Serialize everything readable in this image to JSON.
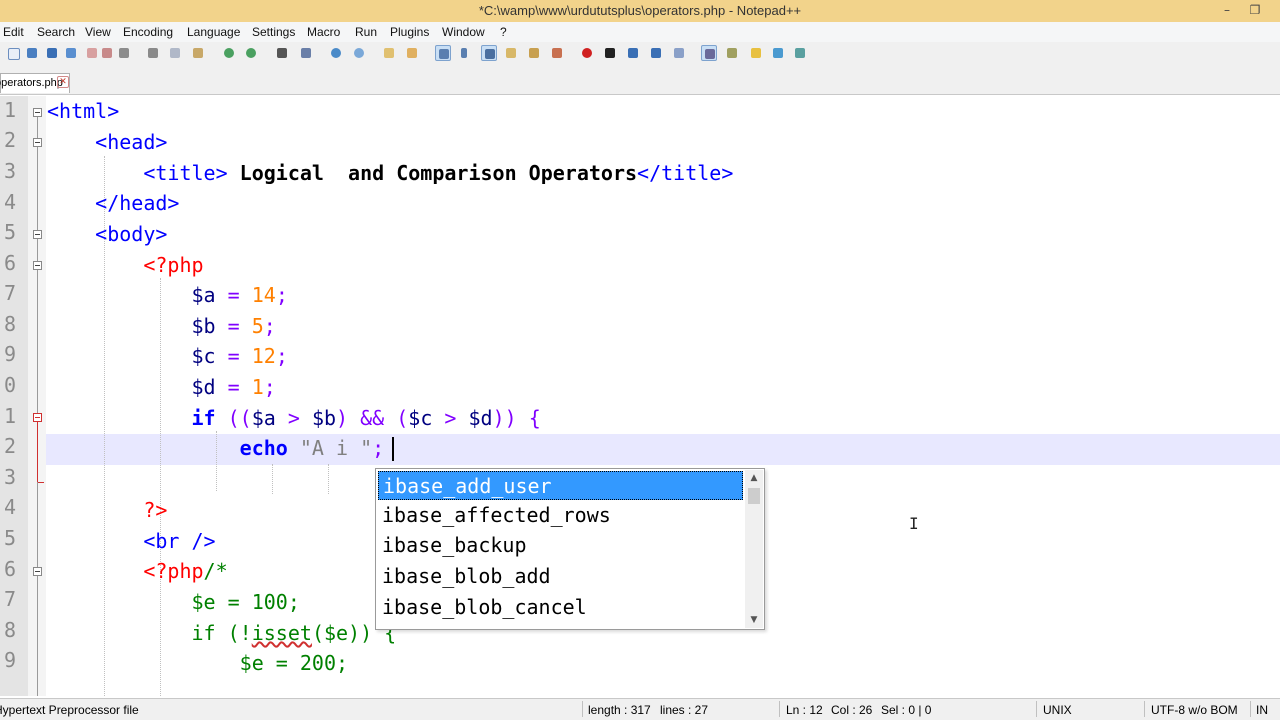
{
  "window": {
    "title": "*C:\\wamp\\www\\urdututsplus\\operators.php - Notepad++",
    "minimize_glyph": "–",
    "restore_glyph": "❐"
  },
  "menu": [
    "Edit",
    "Search",
    "View",
    "Encoding",
    "Language",
    "Settings",
    "Macro",
    "Run",
    "Plugins",
    "Window",
    "?"
  ],
  "tab": {
    "label": "operators.php",
    "close_glyph": "✕"
  },
  "line_numbers": [
    "1",
    "2",
    "3",
    "4",
    "5",
    "6",
    "7",
    "8",
    "9",
    "0",
    "1",
    "2",
    "3",
    "4",
    "5",
    "6",
    "7",
    "8",
    "9"
  ],
  "code": {
    "l1": "<html>",
    "l2": "<head>",
    "l3_open": "<title>",
    "l3_text": " Logical  and Comparison Operators",
    "l3_close": "</title>",
    "l4": "</head>",
    "l5": "<body>",
    "l6": "<?php",
    "l7_var": "$a",
    "l7_op": " = ",
    "l7_num": "14",
    "l7_semi": ";",
    "l8_var": "$b",
    "l8_op": " = ",
    "l8_num": "5",
    "l8_semi": ";",
    "l9_var": "$c",
    "l9_op": " = ",
    "l9_num": "12",
    "l9_semi": ";",
    "l10_var": "$d",
    "l10_op": " = ",
    "l10_num": "1",
    "l10_semi": ";",
    "l11_kw": "if",
    "l11_p1": " ((",
    "l11_a": "$a",
    "l11_gt1": " > ",
    "l11_b": "$b",
    "l11_and": ") && (",
    "l11_c": "$c",
    "l11_gt2": " > ",
    "l11_d": "$d",
    "l11_end": ")) {",
    "l12_kw": "echo",
    "l12_str1": " \"A i",
    "l12_str2": " \"",
    "l12_semi": ";",
    "l14": "?>",
    "l15": "<br />",
    "l16_php": "<?php",
    "l16_cmt": "/*",
    "l17": "$e = 100;",
    "l18_a": "if (!",
    "l18_b": "isset",
    "l18_c": "($e)) {",
    "l19": "$e = 200;"
  },
  "autocomplete": {
    "items": [
      "ibase_add_user",
      "ibase_affected_rows",
      "ibase_backup",
      "ibase_blob_add",
      "ibase_blob_cancel"
    ],
    "selected_index": 0,
    "scroll_up": "▲",
    "scroll_down": "▼"
  },
  "statusbar": {
    "file_type": "Hypertext Preprocessor file",
    "length": "length : 317",
    "lines": "lines : 27",
    "ln": "Ln : 12",
    "col": "Col : 26",
    "sel": "Sel : 0 | 0",
    "eol": "UNIX",
    "encoding": "UTF-8 w/o BOM",
    "mode": "IN"
  },
  "toolbar_icons": [
    "new-file-icon",
    "open-file-icon",
    "save-icon",
    "save-all-icon",
    "close-icon",
    "close-all-icon",
    "print-icon",
    "cut-icon",
    "copy-icon",
    "paste-icon",
    "undo-icon",
    "redo-icon",
    "find-icon",
    "replace-icon",
    "zoom-in-icon",
    "zoom-out-icon",
    "sync-vertical-icon",
    "sync-horizontal-icon",
    "word-wrap-icon",
    "show-all-chars-icon",
    "indent-guide-icon",
    "doc-map-icon",
    "function-list-icon",
    "folder-workspace-icon",
    "record-macro-icon",
    "stop-macro-icon",
    "play-macro-icon",
    "run-macro-multiple-icon",
    "save-macro-icon",
    "spell-check-icon",
    "spell-next-icon",
    "highlighter-icon",
    "compare-icon",
    "spell-settings-icon"
  ]
}
